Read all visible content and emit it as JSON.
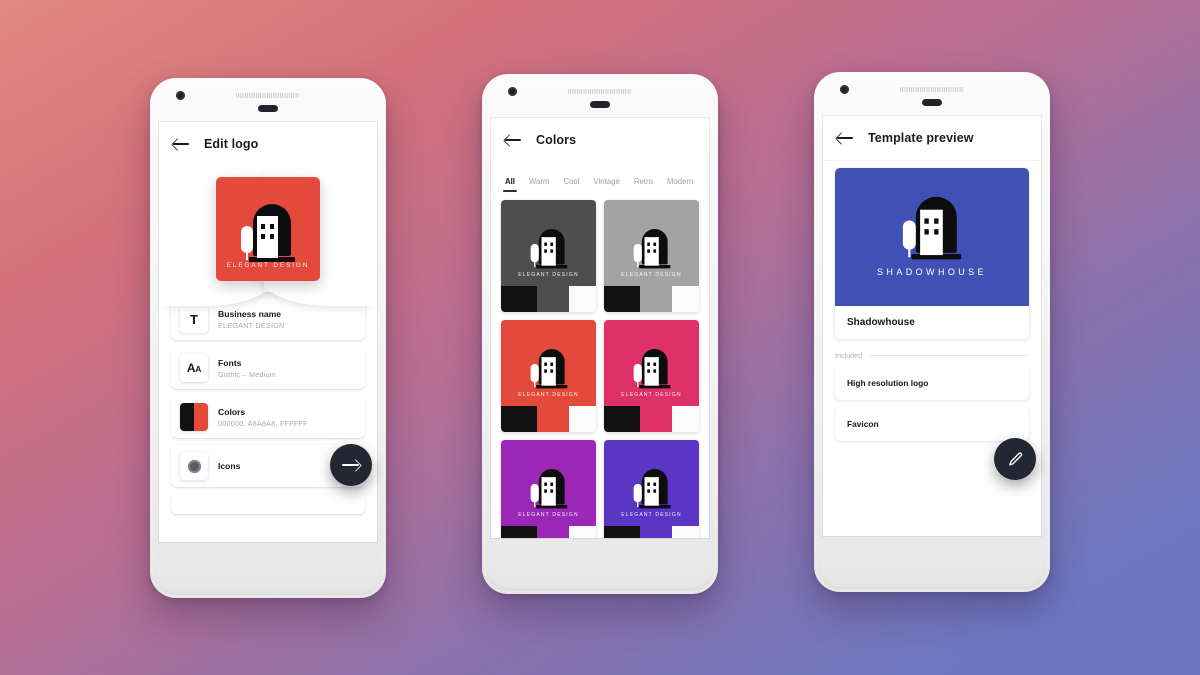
{
  "background": {
    "from": "#e08a7f",
    "to": "#6a73bd"
  },
  "brand": {
    "logo_caption": "ELEGANT DESIGN",
    "accent_red": "#e34a3c",
    "fab_color": "#232733"
  },
  "phone1": {
    "appbar": {
      "title": "Edit logo",
      "back_icon": "arrow-left-icon"
    },
    "logo": {
      "caption": "ELEGANT DESIGN",
      "background": "#e34a3c"
    },
    "rows": [
      {
        "tile": "T",
        "title": "Business name",
        "subtitle": "ELEGANT DESIGN",
        "icon": "text-tile-icon"
      },
      {
        "tile": "Aa",
        "title": "Fonts",
        "subtitle": "Gothic – Medium",
        "icon": "font-tile-icon"
      },
      {
        "tile": "swatch",
        "title": "Colors",
        "subtitle": "000000, A8A8A8, FFFFFF",
        "icon": "color-tile-icon"
      },
      {
        "tile": "dot",
        "title": "Icons",
        "subtitle": "",
        "icon": "icons-tile-icon"
      }
    ],
    "fab": {
      "icon": "arrow-right-icon",
      "label": "Next"
    }
  },
  "phone2": {
    "appbar": {
      "title": "Colors",
      "back_icon": "arrow-left-icon"
    },
    "tabs": [
      {
        "label": "All",
        "active": true
      },
      {
        "label": "Warm",
        "active": false
      },
      {
        "label": "Cool",
        "active": false
      },
      {
        "label": "Vintage",
        "active": false
      },
      {
        "label": "Retro",
        "active": false
      },
      {
        "label": "Modern",
        "active": false
      }
    ],
    "swatches": [
      {
        "name": "dark-gray",
        "bg": "#4e4e4e",
        "caption": "ELEGANT DESIGN",
        "strip": [
          "#111111",
          "#4e4e4e",
          "#fbfbfb"
        ]
      },
      {
        "name": "light-gray",
        "bg": "#a3a3a3",
        "caption": "ELEGANT DESIGN",
        "strip": [
          "#111111",
          "#a3a3a3",
          "#fbfbfb"
        ]
      },
      {
        "name": "red",
        "bg": "#e34a3c",
        "caption": "ELEGANT DESIGN",
        "strip": [
          "#111111",
          "#e34a3c",
          "#fbfbfb"
        ]
      },
      {
        "name": "pink",
        "bg": "#de3169",
        "caption": "ELEGANT DESIGN",
        "strip": [
          "#111111",
          "#de3169",
          "#fbfbfb"
        ]
      },
      {
        "name": "purple",
        "bg": "#9a27b5",
        "caption": "ELEGANT DESIGN",
        "strip": [
          "#111111",
          "#9a27b5",
          "#fbfbfb"
        ]
      },
      {
        "name": "indigo",
        "bg": "#5b35c4",
        "caption": "ELEGANT DESIGN",
        "strip": [
          "#111111",
          "#5b35c4",
          "#fbfbfb"
        ]
      }
    ]
  },
  "phone3": {
    "appbar": {
      "title": "Template preview",
      "back_icon": "arrow-left-icon"
    },
    "template": {
      "hero_bg": "#4150b5",
      "wordmark": "SHADOWHOUSE",
      "name": "Shadowhouse"
    },
    "section_label": "Included",
    "included": [
      {
        "label": "High resolution logo"
      },
      {
        "label": "Favicon"
      }
    ],
    "fab": {
      "icon": "pencil-icon",
      "label": "Edit"
    }
  }
}
